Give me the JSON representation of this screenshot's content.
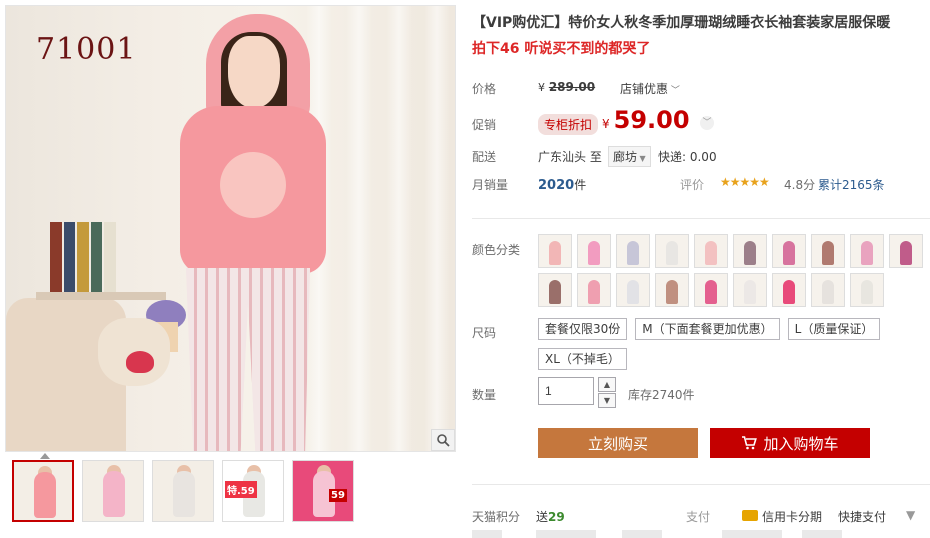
{
  "gallery": {
    "sku_code": "71001",
    "zoom_icon": "magnifier-icon",
    "thumbnails": [
      {
        "id": "thumb-1",
        "selected": true,
        "color": "#f5989e"
      },
      {
        "id": "thumb-2",
        "selected": false,
        "color": "#f4b4c8"
      },
      {
        "id": "thumb-3",
        "selected": false,
        "color": "#e8e4e0"
      },
      {
        "id": "thumb-4",
        "selected": false,
        "color": "#e8e8e4",
        "badge": "特.59"
      },
      {
        "id": "thumb-5",
        "selected": false,
        "color": "#e84a7a",
        "badge": "59"
      }
    ]
  },
  "product": {
    "title": "【VIP购优汇】特价女人秋冬季加厚珊瑚绒睡衣长袖套装家居服保暖",
    "subtitle": "拍下46 听说买不到的都哭了"
  },
  "price": {
    "label": "价格",
    "currency": "¥",
    "original": "289.00",
    "store_promo": "店铺优惠",
    "promo_label": "促销",
    "promo_tag": "专柜折扣",
    "current": "59.00"
  },
  "delivery": {
    "label": "配送",
    "from": "广东汕头",
    "to_word": "至",
    "destination": "廊坊",
    "express": "快递: 0.00"
  },
  "sales": {
    "label": "月销量",
    "count": "2020",
    "unit": "件",
    "rating_label": "评价",
    "stars": "★★★★★",
    "score": "4.8分",
    "cumulative": "累计2165条"
  },
  "colors": {
    "label": "颜色分类",
    "swatches": [
      "#f2b6b6",
      "#f29cc0",
      "#c7c6d8",
      "#e8e6e3",
      "#f3c1c1",
      "#9c7f8a",
      "#d7739e",
      "#b07a70",
      "#e9a3bf",
      "#c05c8a",
      "#9a6f6a",
      "#ef9fb0",
      "#e2e2e6",
      "#c09080",
      "#e4608f",
      "#ece8e6",
      "#e84a7a",
      "#e6e2de",
      "#e8e6e0"
    ]
  },
  "sizes": {
    "label": "尺码",
    "options": [
      "套餐仅限30份",
      "M（下面套餐更加优惠）",
      "L（质量保证）",
      "XL（不掉毛）"
    ]
  },
  "quantity": {
    "label": "数量",
    "value": "1",
    "stock": "库存2740件"
  },
  "actions": {
    "buy_now": "立刻购买",
    "add_cart": "加入购物车"
  },
  "footer": {
    "points_label": "天猫积分",
    "points_prefix": "送",
    "points_value": "29",
    "pay_label": "支付",
    "card_text": "信用卡分期",
    "quick_pay": "快捷支付"
  }
}
